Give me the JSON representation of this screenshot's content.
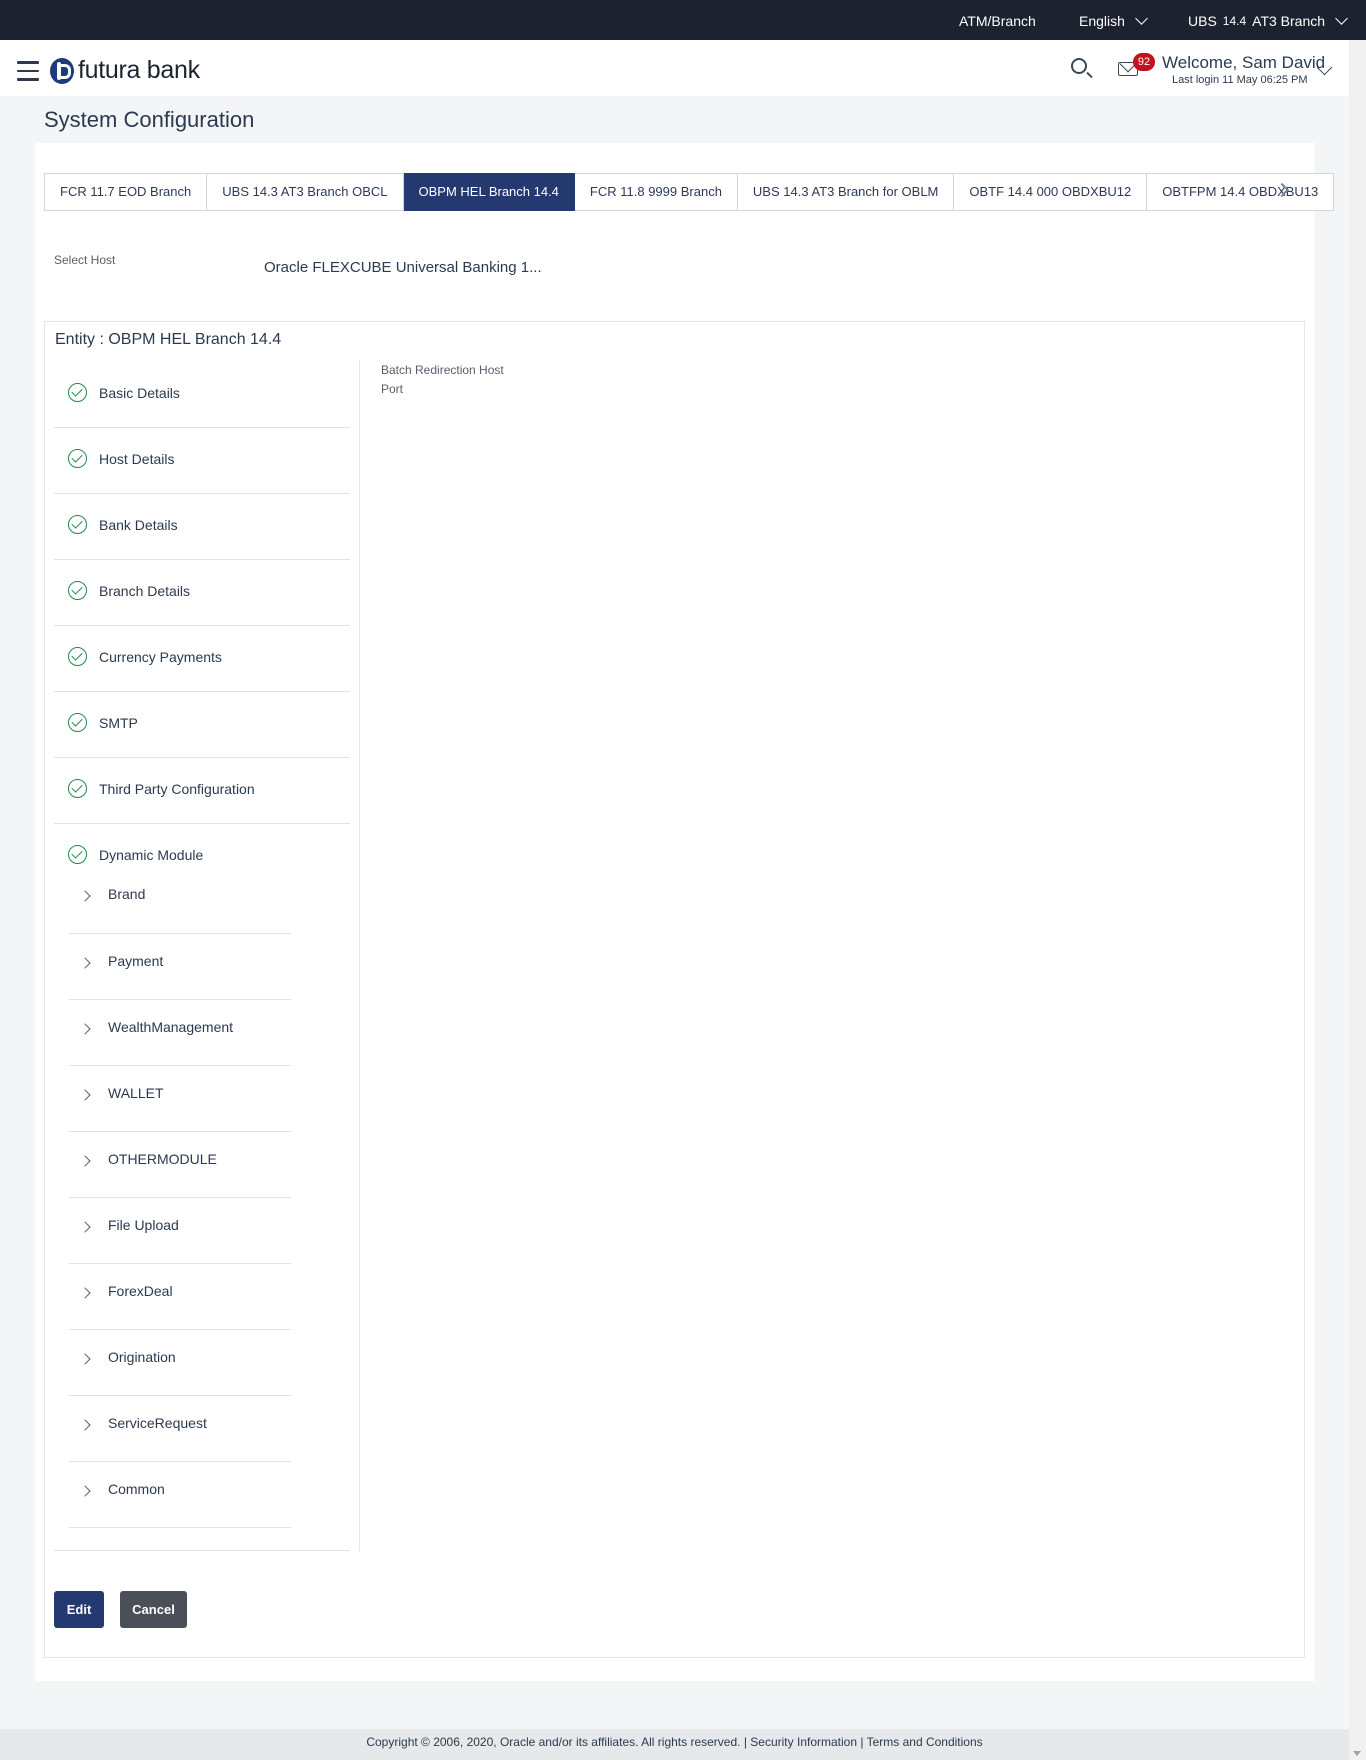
{
  "topbar": {
    "location": "ATM/Branch",
    "language": "English",
    "entity_prefix": "UBS",
    "entity_version": "14.4",
    "entity_suffix": "AT3 Branch"
  },
  "header": {
    "brand": "futura bank",
    "notification_count": "92",
    "welcome": "Welcome, Sam David",
    "last_login": "Last login 11 May 06:25 PM"
  },
  "page": {
    "title": "System Configuration"
  },
  "tabs": [
    {
      "label": "FCR 11.7 EOD Branch",
      "active": false
    },
    {
      "label": "UBS 14.3 AT3 Branch OBCL",
      "active": false
    },
    {
      "label": "OBPM HEL Branch 14.4",
      "active": true
    },
    {
      "label": "FCR 11.8 9999 Branch",
      "active": false
    },
    {
      "label": "UBS 14.3 AT3 Branch for OBLM",
      "active": false
    },
    {
      "label": "OBTF 14.4 000 OBDXBU12",
      "active": false
    },
    {
      "label": "OBTFPM 14.4 OBDXBU13",
      "active": false
    }
  ],
  "host": {
    "label": "Select Host",
    "value": "Oracle FLEXCUBE Universal Banking 1..."
  },
  "entity": {
    "title": "Entity : OBPM HEL Branch 14.4"
  },
  "steps": [
    {
      "label": "Basic Details"
    },
    {
      "label": "Host Details"
    },
    {
      "label": "Bank Details"
    },
    {
      "label": "Branch Details"
    },
    {
      "label": "Currency Payments"
    },
    {
      "label": "SMTP"
    },
    {
      "label": "Third Party Configuration"
    },
    {
      "label": "Dynamic Module"
    }
  ],
  "modules": [
    {
      "label": "Brand"
    },
    {
      "label": "Payment"
    },
    {
      "label": "WealthManagement"
    },
    {
      "label": "WALLET"
    },
    {
      "label": "OTHERMODULE"
    },
    {
      "label": "File Upload"
    },
    {
      "label": "ForexDeal"
    },
    {
      "label": "Origination"
    },
    {
      "label": "ServiceRequest"
    },
    {
      "label": "Common"
    }
  ],
  "details": {
    "field1": "Batch Redirection Host",
    "field2": "Port"
  },
  "actions": {
    "edit": "Edit",
    "cancel": "Cancel"
  },
  "footer": {
    "copyright": "Copyright © 2006, 2020, Oracle and/or its affiliates. All rights reserved.",
    "security": "Security Information",
    "terms": "Terms and Conditions"
  },
  "colors": {
    "topbar": "#1c2230",
    "primary": "#24396f",
    "success": "#1f8a4c",
    "badge": "#c1121f"
  }
}
